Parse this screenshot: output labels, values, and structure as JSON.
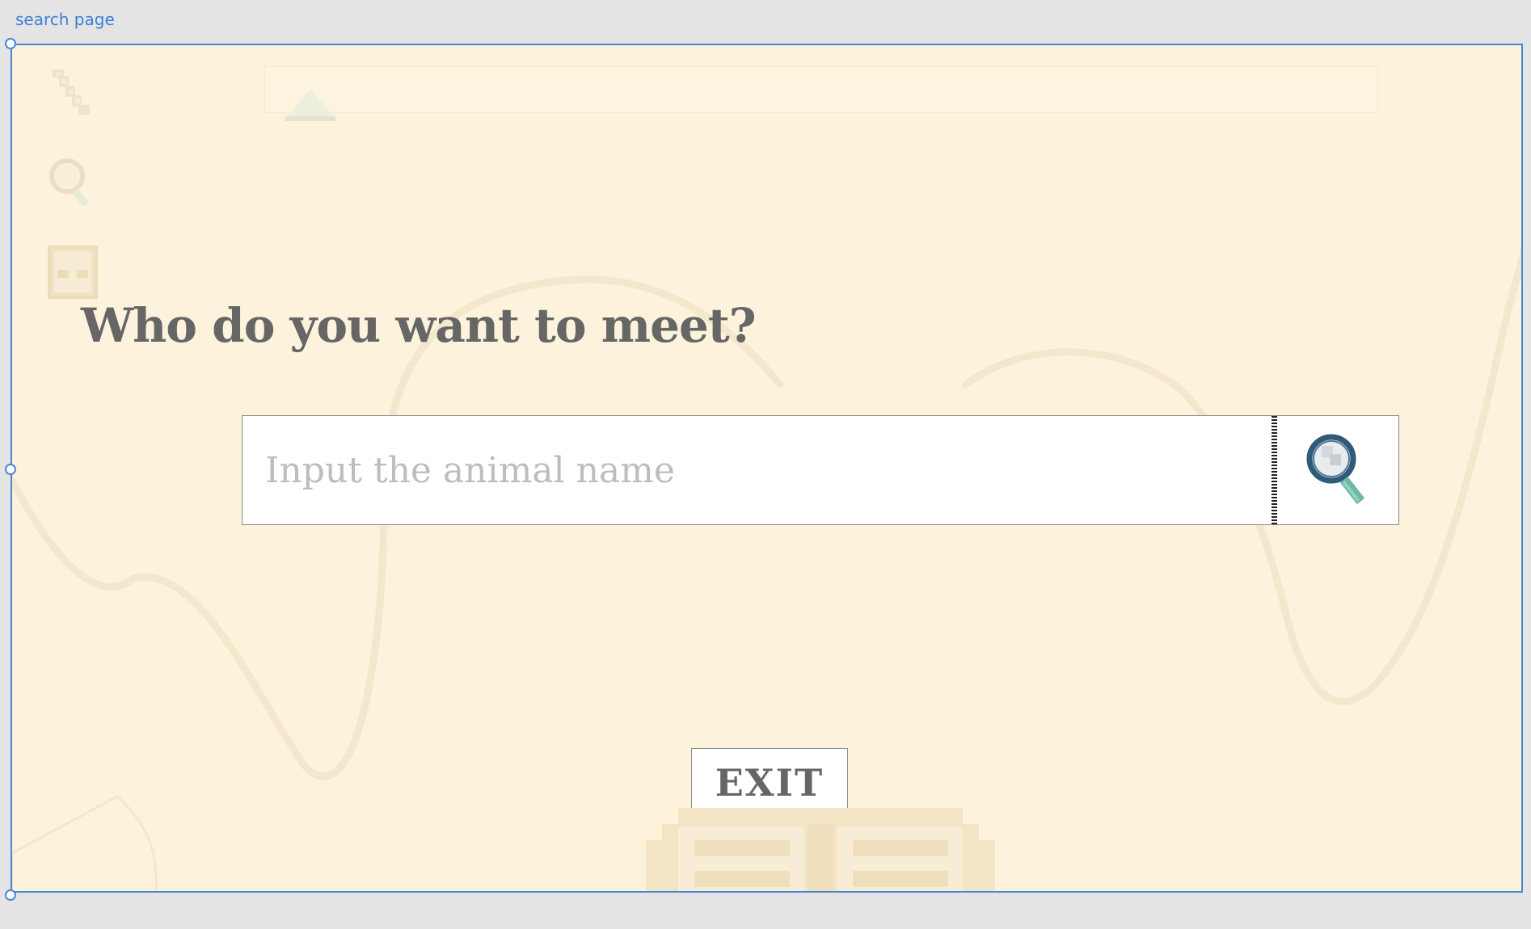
{
  "frame": {
    "label": "search page"
  },
  "sidebar": {
    "icons": [
      "scroll-icon",
      "magnifier-icon",
      "book-icon"
    ]
  },
  "main": {
    "heading": "Who do you want to meet?",
    "search": {
      "placeholder": "Input the animal name",
      "value": "",
      "button_icon": "magnifier-icon"
    },
    "exit_label": "EXIT"
  },
  "colors": {
    "page_background": "#e4e4e4",
    "artboard_background": "#fdf3dc",
    "selection_blue": "#4a86d8",
    "heading_text": "#666666",
    "placeholder_text": "#bdbdbd",
    "magnifier_frame": "#2f5a7a",
    "magnifier_handle": "#6fb7a7"
  }
}
